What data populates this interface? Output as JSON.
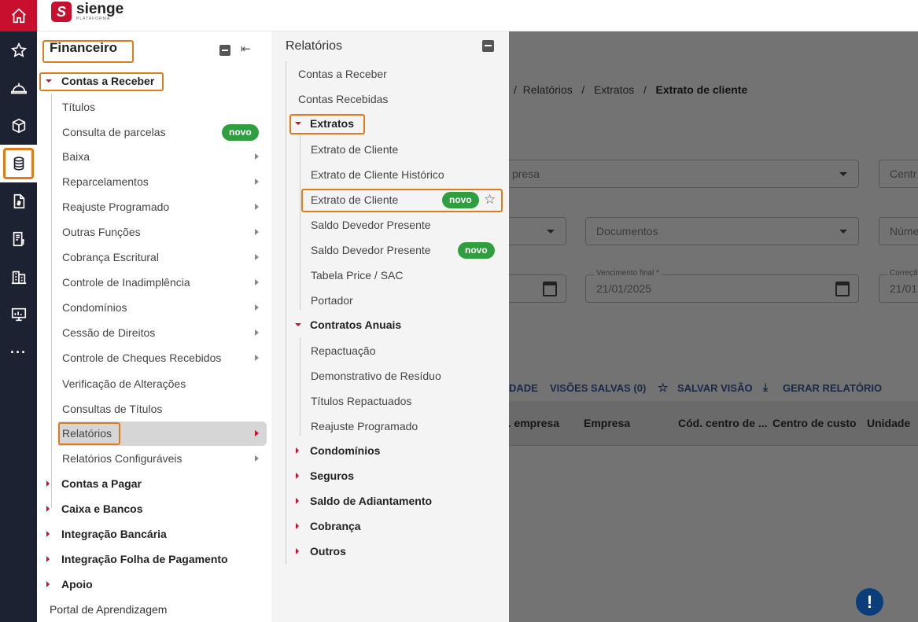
{
  "rail": {
    "items": [
      {
        "icon": "home-icon"
      },
      {
        "icon": "star-icon"
      },
      {
        "icon": "helmet-icon"
      },
      {
        "icon": "box-icon"
      },
      {
        "icon": "coins-icon"
      },
      {
        "icon": "document-dollar-icon"
      },
      {
        "icon": "invoice-icon"
      },
      {
        "icon": "building-icon"
      },
      {
        "icon": "monitor-chart-icon"
      },
      {
        "icon": "more-icon"
      }
    ],
    "more_label": "···"
  },
  "brand": {
    "mark": "S",
    "name": "sienge",
    "sub": "PLATAFORMA",
    "color": "#c8102e"
  },
  "menu": {
    "title": "Financeiro",
    "section": "Contas a Receber",
    "items": [
      {
        "label": "Títulos"
      },
      {
        "label": "Consulta de parcelas",
        "badge": "novo"
      },
      {
        "label": "Baixa"
      },
      {
        "label": "Reparcelamentos"
      },
      {
        "label": "Reajuste Programado"
      },
      {
        "label": "Outras Funções"
      },
      {
        "label": "Cobrança Escritural"
      },
      {
        "label": "Controle de Inadimplência"
      },
      {
        "label": "Condomínios"
      },
      {
        "label": "Cessão de Direitos"
      },
      {
        "label": "Controle de Cheques Recebidos"
      },
      {
        "label": "Verificação de Alterações"
      },
      {
        "label": "Consultas de Títulos"
      },
      {
        "label": "Relatórios"
      },
      {
        "label": "Relatórios Configuráveis"
      }
    ],
    "groups": [
      {
        "label": "Contas a Pagar"
      },
      {
        "label": "Caixa e Bancos"
      },
      {
        "label": "Integração Bancária"
      },
      {
        "label": "Integração Folha de Pagamento"
      },
      {
        "label": "Apoio"
      }
    ],
    "footer_link": "Portal de Aprendizagem"
  },
  "reports": {
    "title": "Relatórios",
    "top": [
      {
        "label": "Contas a Receber"
      },
      {
        "label": "Contas Recebidas"
      }
    ],
    "extratos": {
      "label": "Extratos",
      "items": [
        {
          "label": "Extrato de Cliente"
        },
        {
          "label": "Extrato de Cliente Histórico"
        },
        {
          "label": "Extrato de Cliente",
          "badge": "novo"
        },
        {
          "label": "Saldo Devedor Presente"
        },
        {
          "label": "Saldo Devedor Presente",
          "badge": "novo"
        },
        {
          "label": "Tabela Price / SAC"
        },
        {
          "label": "Portador"
        }
      ]
    },
    "contratos": {
      "label": "Contratos Anuais",
      "items": [
        {
          "label": "Repactuação"
        },
        {
          "label": "Demonstrativo de Resíduo"
        },
        {
          "label": "Títulos Repactuados"
        },
        {
          "label": "Reajuste Programado"
        }
      ]
    },
    "groups": [
      {
        "label": "Condomínios"
      },
      {
        "label": "Seguros"
      },
      {
        "label": "Saldo de Adiantamento"
      },
      {
        "label": "Cobrança"
      },
      {
        "label": "Outros"
      }
    ]
  },
  "background": {
    "breadcrumb": {
      "a": "Relatórios",
      "b": "Extratos",
      "current": "Extrato de cliente",
      "sep": "/"
    },
    "fields": {
      "empresa": "presa",
      "centro": "Centr",
      "documentos": "Documentos",
      "numero": "Núme",
      "venc_label": "Vencimento final *",
      "venc_value": "21/01/2025",
      "corr_label": "Correçã",
      "corr_value": "21/01"
    },
    "actions": {
      "a": "DADE",
      "b": "VISÕES SALVAS (0)",
      "c": "SALVAR VISÃO",
      "d": "GERAR RELATÓRIO"
    },
    "columns": [
      "). empresa",
      "Empresa",
      "Cód. centro de ...",
      "Centro de custo",
      "Unidade"
    ],
    "help": "!"
  },
  "colors": {
    "accent": "#c8102e",
    "highlight": "#e07b1a",
    "badge": "#2e9e3e",
    "rail": "#1d2233"
  }
}
